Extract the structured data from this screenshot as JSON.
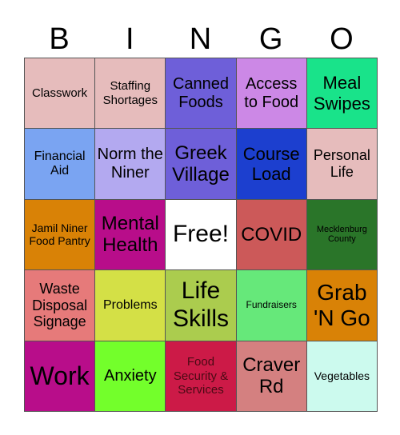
{
  "header": {
    "letters": [
      "B",
      "I",
      "N",
      "G",
      "O"
    ]
  },
  "cells": [
    {
      "text": "Classwork",
      "bg": "#e6bcbc",
      "fs": 15
    },
    {
      "text": "Staffing Shortages",
      "bg": "#e6bcbc",
      "fs": 15
    },
    {
      "text": "Canned Foods",
      "bg": "#6e5fd9",
      "fs": 20
    },
    {
      "text": "Access to Food",
      "bg": "#cc88e6",
      "fs": 20
    },
    {
      "text": "Meal Swipes",
      "bg": "#19e38a",
      "fs": 22
    },
    {
      "text": "Financial Aid",
      "bg": "#7aa4f2",
      "fs": 16
    },
    {
      "text": "Norm the Niner",
      "bg": "#b3a9f0",
      "fs": 20
    },
    {
      "text": "Greek Village",
      "bg": "#6e5fd9",
      "fs": 24
    },
    {
      "text": "Course Load",
      "bg": "#1c3fcf",
      "fs": 22
    },
    {
      "text": "Personal Life",
      "bg": "#e6bcbc",
      "fs": 18
    },
    {
      "text": "Jamil Niner Food Pantry",
      "bg": "#d98206",
      "fs": 14
    },
    {
      "text": "Mental Health",
      "bg": "#b80d8a",
      "fs": 24
    },
    {
      "text": "Free!",
      "bg": "#ffffff",
      "fs": 30
    },
    {
      "text": "COVID",
      "bg": "#cc5959",
      "fs": 24
    },
    {
      "text": "Mecklenburg County",
      "bg": "#2a7529",
      "fs": 11
    },
    {
      "text": "Waste Disposal Signage",
      "bg": "#e67a7a",
      "fs": 18
    },
    {
      "text": "Problems",
      "bg": "#d4e046",
      "fs": 16
    },
    {
      "text": "Life Skills",
      "bg": "#abcc4e",
      "fs": 30
    },
    {
      "text": "Fundraisers",
      "bg": "#66e87a",
      "fs": 12
    },
    {
      "text": "Grab 'N Go",
      "bg": "#d98206",
      "fs": 28
    },
    {
      "text": "Work",
      "bg": "#b80d8a",
      "fs": 32
    },
    {
      "text": "Anxiety",
      "bg": "#73ff2b",
      "fs": 20
    },
    {
      "text": "Food Security & Services",
      "bg": "#cc1a47",
      "fs": 15,
      "color": "#4a0a14"
    },
    {
      "text": "Craver Rd",
      "bg": "#d48080",
      "fs": 24
    },
    {
      "text": "Vegetables",
      "bg": "#ccfaee",
      "fs": 14
    }
  ]
}
